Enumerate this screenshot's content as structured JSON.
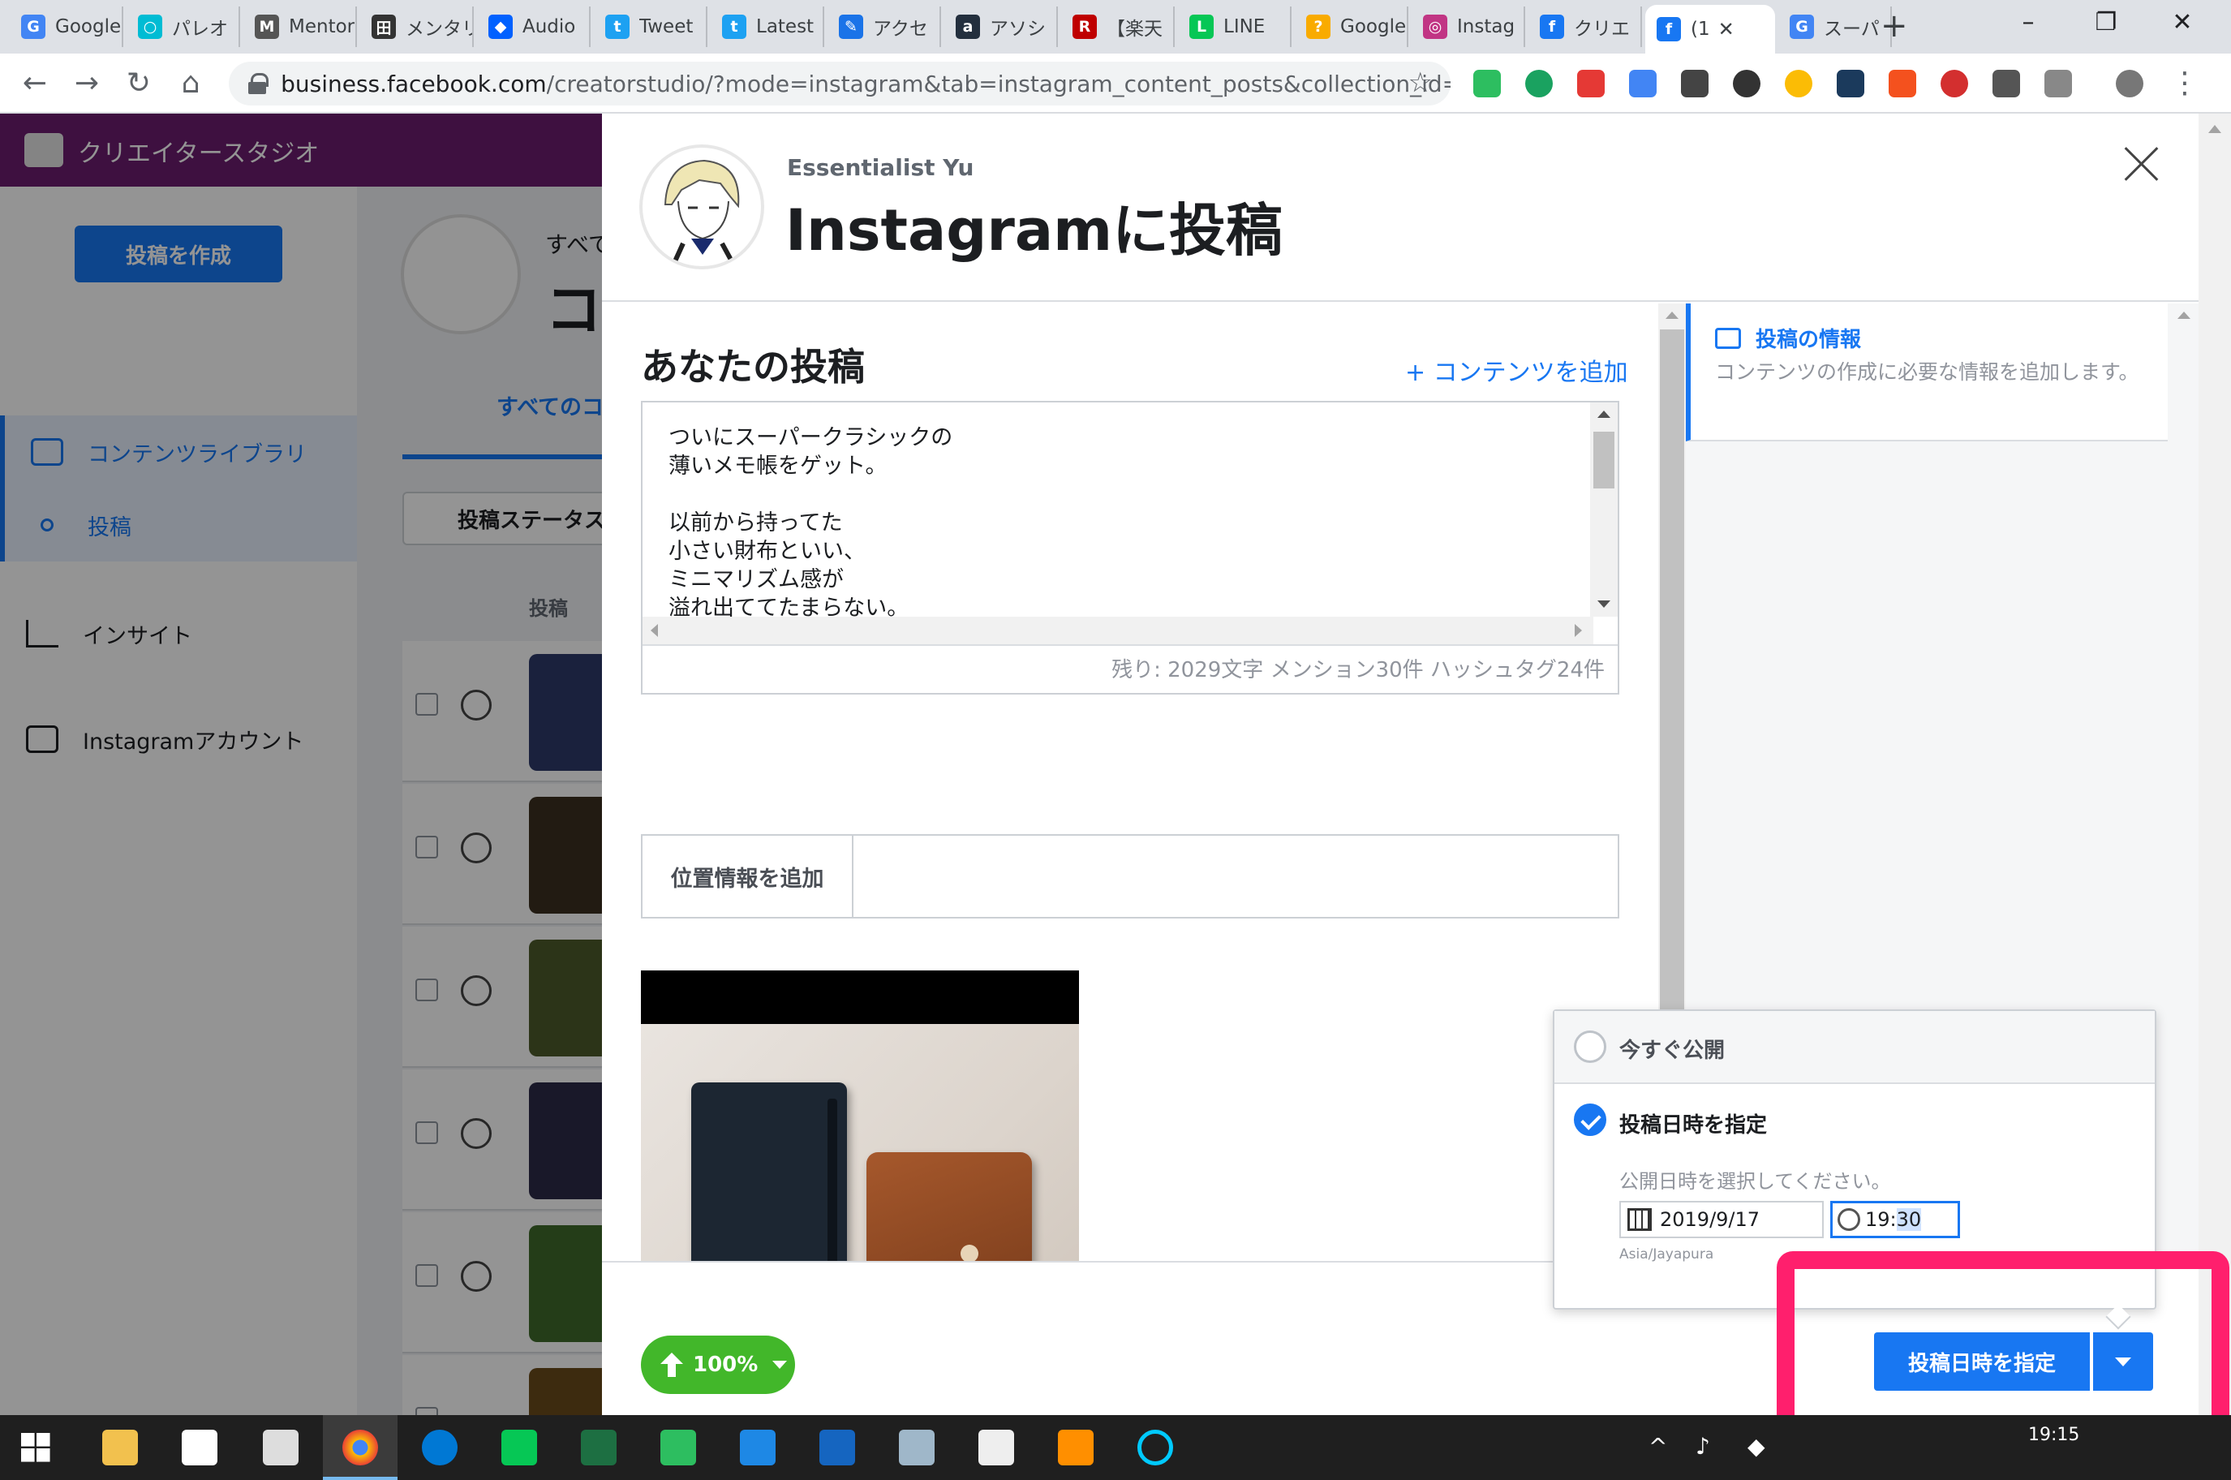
{
  "browser": {
    "tabs": [
      {
        "title": "Google",
        "icon": "google-icon",
        "color": "#4285f4",
        "glyph": "G"
      },
      {
        "title": "パレオ",
        "icon": "circle-icon",
        "color": "#00bcd4",
        "glyph": "○"
      },
      {
        "title": "Mentor",
        "icon": "mentor-icon",
        "color": "#555555",
        "glyph": "M"
      },
      {
        "title": "メンタリ",
        "icon": "mentor-icon",
        "color": "#333333",
        "glyph": "田"
      },
      {
        "title": "Audio",
        "icon": "dropbox-icon",
        "color": "#0061ff",
        "glyph": "◆"
      },
      {
        "title": "Tweet",
        "icon": "twitter-icon",
        "color": "#1da1f2",
        "glyph": "t"
      },
      {
        "title": "Latest",
        "icon": "twitter-icon",
        "color": "#1da1f2",
        "glyph": "t"
      },
      {
        "title": "アクセ",
        "icon": "edit-icon",
        "color": "#1a73e8",
        "glyph": "✎"
      },
      {
        "title": "アソシ",
        "icon": "amazon-icon",
        "color": "#232f3e",
        "glyph": "a"
      },
      {
        "title": "【楽天",
        "icon": "rakuten-icon",
        "color": "#bf0000",
        "glyph": "R"
      },
      {
        "title": "LINE",
        "icon": "line-icon",
        "color": "#06c755",
        "glyph": "L"
      },
      {
        "title": "Google",
        "icon": "bulb-icon",
        "color": "#f9ab00",
        "glyph": "?"
      },
      {
        "title": "Instag",
        "icon": "instagram-icon",
        "color": "#c13584",
        "glyph": "◎"
      },
      {
        "title": "クリエ",
        "icon": "facebook-icon",
        "color": "#1877f2",
        "glyph": "f"
      },
      {
        "title": "(1",
        "icon": "facebook-icon",
        "color": "#1877f2",
        "glyph": "f"
      },
      {
        "title": "スーパ",
        "icon": "google-icon",
        "color": "#4285f4",
        "glyph": "G"
      }
    ],
    "active_tab_index": 14,
    "url_host": "business.facebook.com",
    "url_path": "/creatorstudio/?mode=instagram&tab=instagram_content_posts&collection_id=all_p..."
  },
  "studio": {
    "title": "クリエイタースタジオ",
    "create_post": "投稿を作成",
    "sidebar": [
      {
        "label": "コンテンツライブラリ",
        "selected": true
      },
      {
        "label": "投稿",
        "selected": true
      },
      {
        "label": "インサイト",
        "selected": false
      },
      {
        "label": "Instagramアカウント",
        "selected": false
      }
    ],
    "bg_everything": "すべて",
    "bg_big_char": "コ",
    "bg_tab": "すべてのコ",
    "bg_filter": "投稿ステータス",
    "bg_col_post": "投稿"
  },
  "modal": {
    "account_name": "Essentialist Yu",
    "title": "Instagramに投稿",
    "posts_heading": "あなたの投稿",
    "add_content": "+ コンテンツを追加",
    "caption": "ついにスーパークラシックの\n薄いメモ帳をゲット。\n\n以前から持ってた\n小さい財布といい、\nミニマリズム感が\n溢れ出ててたまらない。",
    "counter": "残り: 2029文字 メンション30件 ハッシュタグ24件",
    "location_label": "位置情報を追加",
    "info_title": "投稿の情報",
    "info_desc": "コンテンツの作成に必要な情報を追加します。",
    "upload_progress": "100%"
  },
  "schedule": {
    "publish_now": "今すぐ公開",
    "schedule_option": "投稿日時を指定",
    "hint": "公開日時を選択してください。",
    "date": "2019/9/17",
    "time_hour": "19",
    "time_sep": ":",
    "time_minute": "30",
    "timezone": "Asia/Jayapura",
    "selected": "schedule",
    "button_label": "投稿日時を指定"
  },
  "taskbar": {
    "clock": "19:15"
  },
  "colors": {
    "accent": "#1877f2",
    "highlight": "#ff1f6d",
    "upload": "#42b72a"
  }
}
